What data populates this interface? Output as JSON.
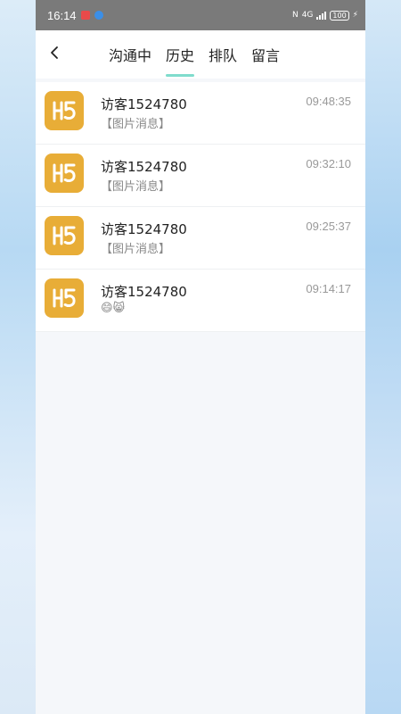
{
  "status_bar": {
    "time": "16:14",
    "network": "4G",
    "battery": "100"
  },
  "header": {
    "tabs": [
      {
        "label": "沟通中",
        "active": false
      },
      {
        "label": "历史",
        "active": true
      },
      {
        "label": "排队",
        "active": false
      },
      {
        "label": "留言",
        "active": false
      }
    ]
  },
  "conversations": [
    {
      "name": "访客1524780",
      "time": "09:48:35",
      "message": "【图片消息】"
    },
    {
      "name": "访客1524780",
      "time": "09:32:10",
      "message": "【图片消息】"
    },
    {
      "name": "访客1524780",
      "time": "09:25:37",
      "message": "【图片消息】"
    },
    {
      "name": "访客1524780",
      "time": "09:14:17",
      "message": "😄😸"
    }
  ],
  "colors": {
    "accent": "#7fdccd",
    "avatar_bg": "#e8ad37",
    "status_bar_bg": "#7a7a7a"
  }
}
